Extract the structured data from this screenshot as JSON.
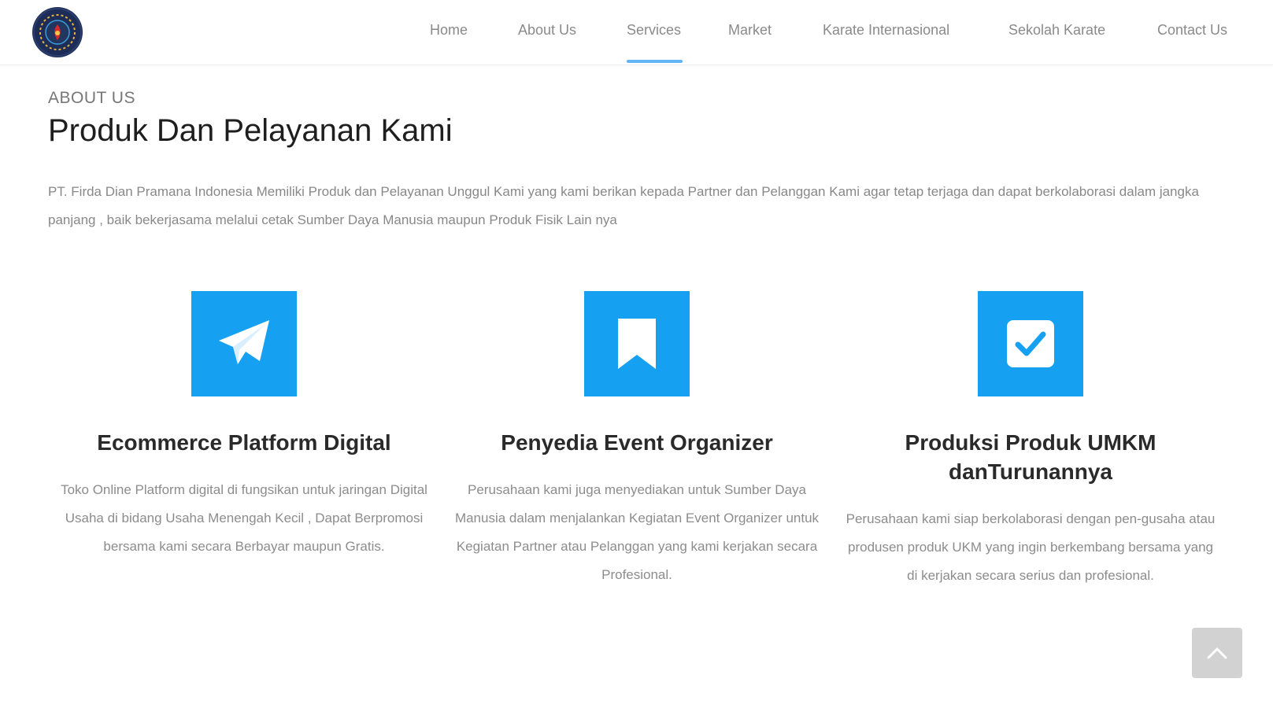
{
  "header": {
    "logo_name": "company-logo",
    "nav": [
      {
        "label": "Home"
      },
      {
        "label": "About Us"
      },
      {
        "label": "Services",
        "active": true
      },
      {
        "label": "Market"
      },
      {
        "label": "Karate Internasional"
      },
      {
        "label": "Sekolah Karate"
      },
      {
        "label": "Contact Us"
      }
    ]
  },
  "intro": {
    "eyebrow": "ABOUT US",
    "title": "Produk Dan Pelayanan Kami",
    "text": "PT. Firda Dian Pramana Indonesia Memiliki Produk dan Pelayanan Unggul Kami yang kami berikan kepada Partner dan Pelanggan Kami agar tetap terjaga dan dapat berkolaborasi dalam jangka panjang , baik bekerjasama melalui cetak Sumber Daya Manusia maupun Produk Fisik Lain nya"
  },
  "services": [
    {
      "icon": "paper-plane-icon",
      "title": "Ecommerce Platform Digital",
      "text": "Toko Online Platform digital di fungsikan untuk jaringan Digital Usaha di bidang Usaha Menengah Kecil , Dapat Berpromosi bersama kami secara Berbayar maupun Gratis."
    },
    {
      "icon": "bookmark-icon",
      "title": "Penyedia Event Organizer",
      "text": "Perusahaan kami juga menyediakan untuk Sumber Daya Manusia dalam menjalankan Kegiatan Event Organizer untuk Kegiatan Partner atau Pelanggan yang kami kerjakan secara Profesional."
    },
    {
      "icon": "checkbox-icon",
      "title": "Produksi Produk UMKM danTurunannya",
      "text": "Perusahaan kami siap berkolaborasi dengan pen-gusaha atau produsen produk UKM yang ingin berkembang bersama yang di kerjakan secara serius dan profesional."
    }
  ],
  "colors": {
    "accent": "#16a0f2",
    "nav_underline": "#64b5f6",
    "scroll_top_bg": "#d2d2d2"
  }
}
